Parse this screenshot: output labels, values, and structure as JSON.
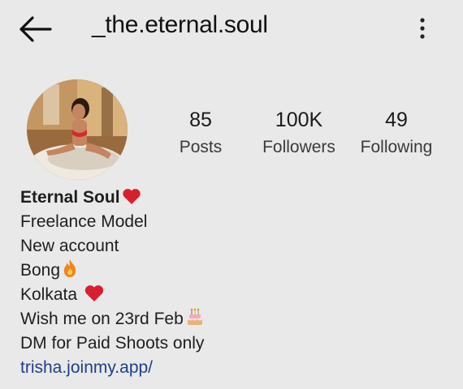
{
  "header": {
    "back_icon": "back-arrow-icon",
    "username": "_the.eternal.soul",
    "menu_icon": "more-vertical-icon"
  },
  "stats": [
    {
      "value": "85",
      "label": "Posts"
    },
    {
      "value": "100K",
      "label": "Followers"
    },
    {
      "value": "49",
      "label": "Following"
    }
  ],
  "bio": {
    "name": "Eternal Soul",
    "lines": [
      "Freelance Model",
      "New account",
      "Bong",
      "Kolkata",
      "Wish me on 23rd Feb",
      "DM for Paid Shoots only"
    ],
    "link": "trisha.joinmy.app/"
  },
  "icons": {
    "heart": "heart-icon",
    "fire": "fire-icon",
    "cake": "birthday-cake-icon"
  },
  "colors": {
    "background": "#e8e9e8",
    "link": "#1f3f86",
    "heart": "#d6202e"
  }
}
